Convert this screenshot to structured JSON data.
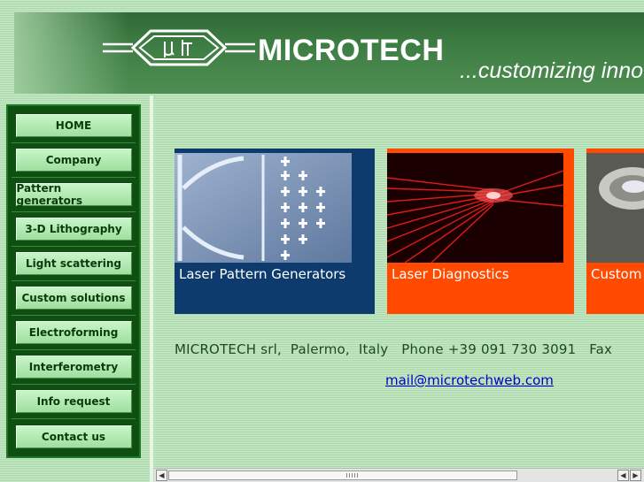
{
  "header": {
    "brand": "MICROTECH",
    "tagline": "...customizing inno",
    "logo_icon": "micro-symbol-logo"
  },
  "nav": {
    "items": [
      {
        "label": "HOME"
      },
      {
        "label": "Company"
      },
      {
        "label": "Pattern generators"
      },
      {
        "label": "3-D Lithography"
      },
      {
        "label": "Light scattering"
      },
      {
        "label": "Custom solutions"
      },
      {
        "label": "Electroforming"
      },
      {
        "label": "Interferometry"
      },
      {
        "label": "Info request"
      },
      {
        "label": "Contact us"
      }
    ]
  },
  "tiles": [
    {
      "label": "Laser Pattern Generators",
      "color": "#0d3b6d"
    },
    {
      "label": "Laser Diagnostics",
      "color": "#ff4a00"
    },
    {
      "label": "Custom",
      "color": "#ff4a00"
    }
  ],
  "footer": {
    "contact_line": "MICROTECH srl,  Palermo,  Italy   Phone +39 091 730 3091   Fax",
    "email": "mail@microtechweb.com"
  },
  "colors": {
    "banner": "#3f7f45",
    "sidebar": "#0f4f12",
    "nav_button": "#b5edb5",
    "text": "#1c4a20",
    "link": "#0000cc"
  }
}
